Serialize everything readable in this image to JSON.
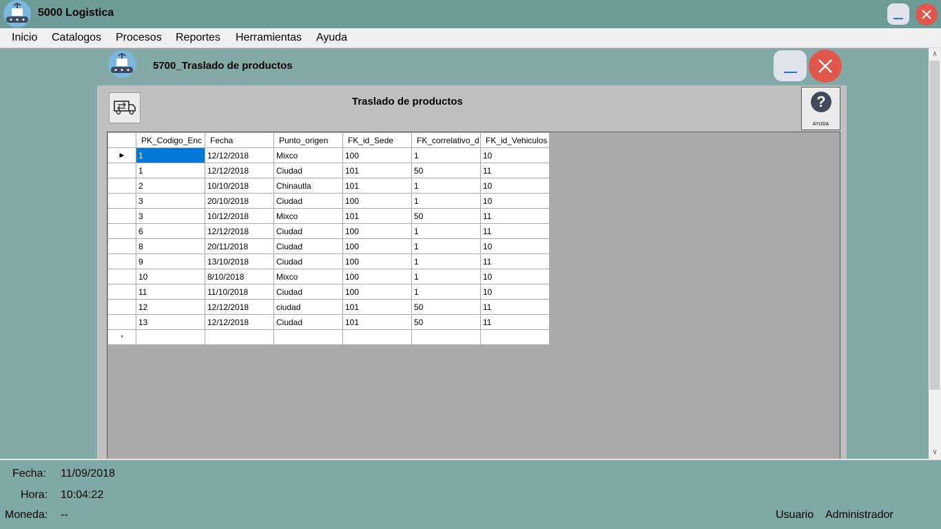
{
  "app": {
    "title": "5000 Logistica"
  },
  "menu": [
    "Inicio",
    "Catalogos",
    "Procesos",
    "Reportes",
    "Herramientas",
    "Ayuda"
  ],
  "child": {
    "title": "5700_Traslado de productos",
    "panel_title": "Traslado de productos",
    "help_label": "AYUDA",
    "help_glyph": "?"
  },
  "grid": {
    "columns": [
      "PK_Codigo_Enc",
      "Fecha",
      "Punto_origen",
      "FK_id_Sede",
      "FK_correlativo_d",
      "FK_id_Vehiculos"
    ],
    "current_row_marker": "▶",
    "new_row_marker": "*",
    "rows": [
      [
        "1",
        "12/12/2018",
        "Mixco",
        "100",
        "1",
        "10"
      ],
      [
        "1",
        "12/12/2018",
        "Ciudad",
        "101",
        "50",
        "11"
      ],
      [
        "2",
        "10/10/2018",
        "Chinautla",
        "101",
        "1",
        "10"
      ],
      [
        "3",
        "20/10/2018",
        "Ciudad",
        "100",
        "1",
        "10"
      ],
      [
        "3",
        "10/12/2018",
        "Mixco",
        "101",
        "50",
        "11"
      ],
      [
        "6",
        "12/12/2018",
        "Ciudad",
        "100",
        "1",
        "11"
      ],
      [
        "8",
        "20/11/2018",
        "Ciudad",
        "100",
        "1",
        "10"
      ],
      [
        "9",
        "13/10/2018",
        "Ciudad",
        "100",
        "1",
        "11"
      ],
      [
        "10",
        "8/10/2018",
        "Mixco",
        "100",
        "1",
        "10"
      ],
      [
        "11",
        "11/10/2018",
        "Ciudad",
        "100",
        "1",
        "10"
      ],
      [
        "12",
        "12/12/2018",
        "ciudad",
        "101",
        "50",
        "11"
      ],
      [
        "13",
        "12/12/2018",
        "Ciudad",
        "101",
        "50",
        "11"
      ]
    ]
  },
  "status": {
    "fecha_label": "Fecha:",
    "fecha": "11/09/2018",
    "hora_label": "Hora:",
    "hora": "10:04:22",
    "moneda_label": "Moneda:",
    "moneda": "--",
    "usuario_label": "Usuario",
    "usuario": "Administrador"
  },
  "colors": {
    "background": "#7fa9a6",
    "titlebar": "#6c9b98",
    "close": "#e2574c",
    "selection": "#0078d7"
  }
}
